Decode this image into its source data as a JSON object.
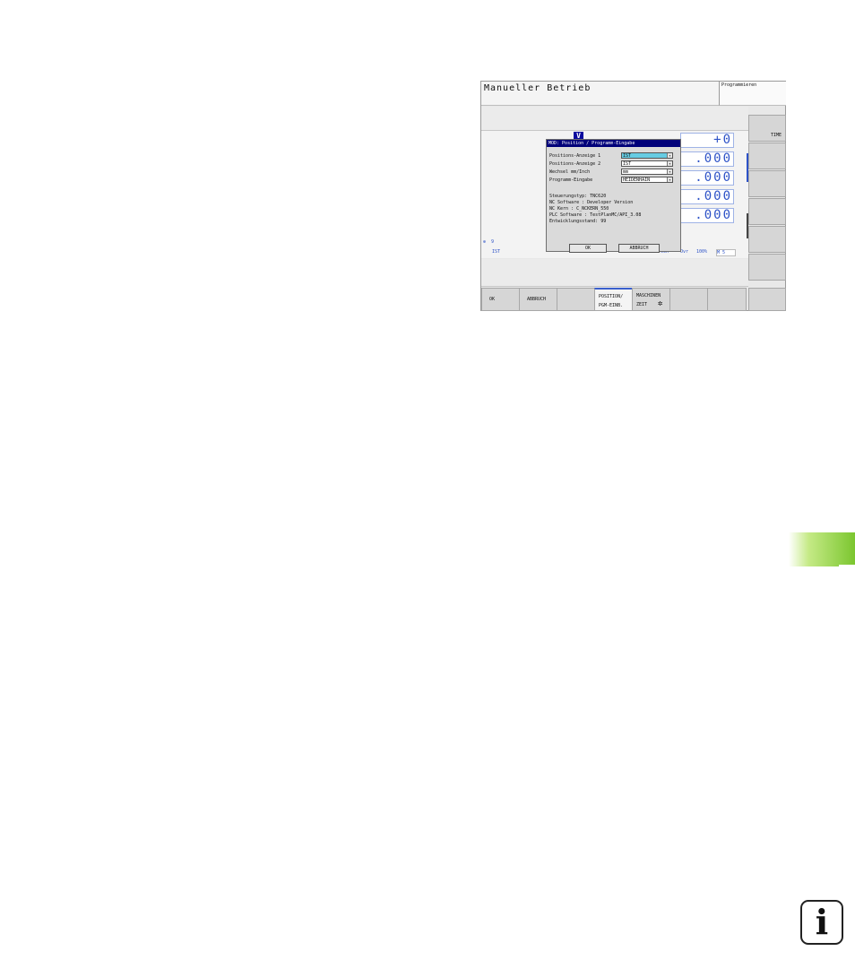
{
  "header": {
    "title": "Manueller Betrieb",
    "mode_label": "Programmieren"
  },
  "softkeys_vertical": [
    {
      "label": "TIME"
    },
    {
      "label": ""
    },
    {
      "label": ""
    },
    {
      "label": ""
    },
    {
      "label": ""
    },
    {
      "label": ""
    }
  ],
  "softkeys_horizontal": [
    {
      "label": "OK"
    },
    {
      "label": "ABBRUCH"
    },
    {
      "label": ""
    },
    {
      "line1": "POSITION/",
      "line2": "PGM-EINB.",
      "active": true
    },
    {
      "line1": "MASCHINEN",
      "line2": "ZEIT"
    },
    {
      "label": ""
    },
    {
      "label": ""
    }
  ],
  "position_display": {
    "axis_marker": "V",
    "values": [
      "0.000",
      ".000",
      ".000",
      ".000",
      ".000"
    ],
    "first_prefix": "+0"
  },
  "dialog": {
    "title": "MOD: Position / Programm-Eingabe",
    "fields": [
      {
        "label": "Positions-Anzeige 1",
        "value": "IST",
        "highlighted": true
      },
      {
        "label": "Positions-Anzeige 2",
        "value": "IST",
        "highlighted": false
      },
      {
        "label": "Wechsel mm/Inch",
        "value": "mm",
        "highlighted": false
      },
      {
        "label": "Programm-Eingabe",
        "value": "HEIDENHAIN",
        "highlighted": false
      }
    ],
    "info": [
      "Steuerungstyp: TNC620",
      "NC Software  : Developer Version",
      "NC Kern      : C_NCKERN_550",
      "PLC Software : TestPlanMC/API_3.08",
      "Entwicklungsstand: 99"
    ],
    "ok_label": "OK",
    "cancel_label": "ABBRUCH"
  },
  "status_bar": {
    "line1_text": "9",
    "line2_items": [
      "IST",
      "1",
      "3  2  3",
      "0",
      "1",
      "Uebrsch",
      "Ovr",
      "100%",
      "M 5"
    ]
  },
  "page_icon": {
    "name": "info-icon",
    "glyph": "i"
  },
  "colors": {
    "accent_blue": "#2d52c7",
    "dialog_title": "#00007a",
    "highlight": "#66cce3",
    "green_tab": "#7bc62f"
  }
}
